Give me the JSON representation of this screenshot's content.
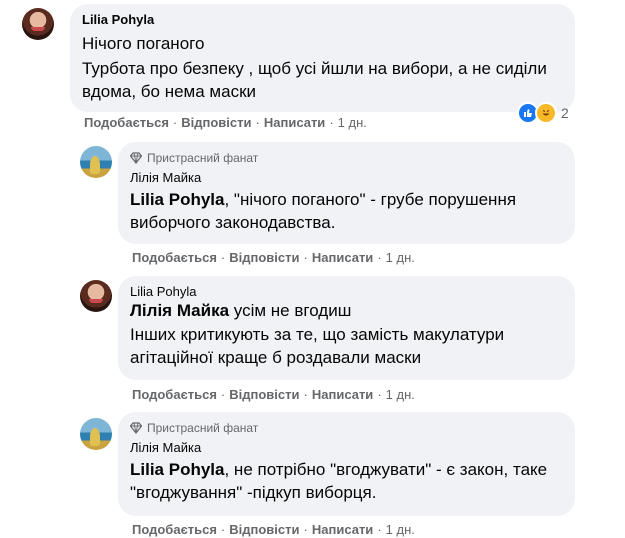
{
  "comments": [
    {
      "author": "Lilia Pohyla",
      "lines": [
        "Нічого поганого",
        "Турбота про безпеку , щоб усі йшли на вибори, а не сиділи вдома, бо нема маски"
      ],
      "actions": {
        "like": "Подобається",
        "reply": "Відповісти",
        "write": "Написати",
        "time": "1 дн."
      },
      "reactions": {
        "icons": [
          "like-icon",
          "haha-icon"
        ],
        "count": "2"
      }
    },
    {
      "badge": "Пристрасний фанат",
      "author": "Лілія Майка",
      "mention": "Lilia Pohyla",
      "text": ", \"нічого поганого\" - грубе порушення виборчого законодавства.",
      "actions": {
        "like": "Подобається",
        "reply": "Відповісти",
        "write": "Написати",
        "time": "1 дн."
      }
    },
    {
      "author": "Lilia Pohyla",
      "mention": "Лілія Майка",
      "mention_rest": " усім не вгодиш",
      "text": "Інших критикують за те, що замість макулатури агітаційної краще б роздавали маски",
      "actions": {
        "like": "Подобається",
        "reply": "Відповісти",
        "write": "Написати",
        "time": "1 дн."
      }
    },
    {
      "badge": "Пристрасний фанат",
      "author": "Лілія Майка",
      "mention": "Lilia Pohyla",
      "text": ", не потрібно \"вгоджувати\" - є закон, таке \"вгоджування\" -підкуп виборця.",
      "actions": {
        "like": "Подобається",
        "reply": "Відповісти",
        "write": "Написати",
        "time": "1 дн."
      }
    }
  ],
  "colors": {
    "bubble": "#f0f2f5",
    "meta": "#65676b",
    "text": "#050505",
    "like": "#1877f2"
  }
}
